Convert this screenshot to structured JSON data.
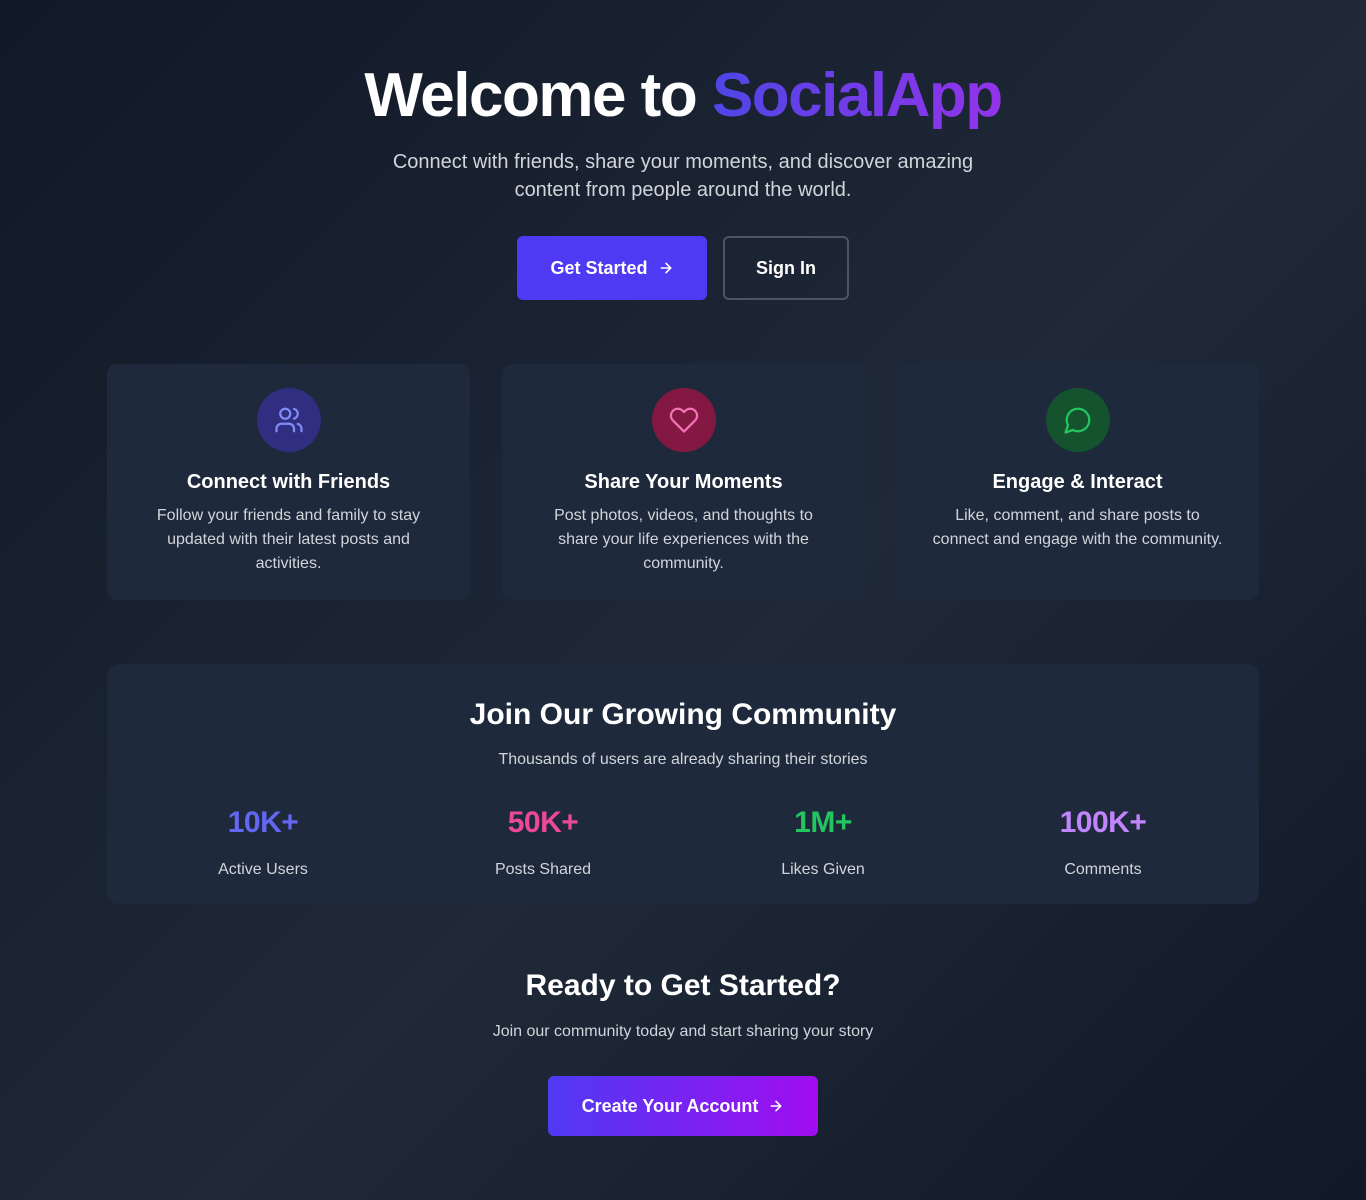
{
  "hero": {
    "title_prefix": "Welcome to ",
    "title_brand": "SocialApp",
    "subtitle": "Connect with friends, share your moments, and discover amazing content from people around the world.",
    "get_started_label": "Get Started",
    "sign_in_label": "Sign In"
  },
  "features": [
    {
      "icon": "users-icon",
      "title": "Connect with Friends",
      "description": "Follow your friends and family to stay updated with their latest posts and activities."
    },
    {
      "icon": "heart-icon",
      "title": "Share Your Moments",
      "description": "Post photos, videos, and thoughts to share your life experiences with the community."
    },
    {
      "icon": "message-circle-icon",
      "title": "Engage & Interact",
      "description": "Like, comment, and share posts to connect and engage with the community."
    }
  ],
  "community": {
    "title": "Join Our Growing Community",
    "subtitle": "Thousands of users are already sharing their stories",
    "stats": [
      {
        "value": "10K+",
        "label": "Active Users"
      },
      {
        "value": "50K+",
        "label": "Posts Shared"
      },
      {
        "value": "1M+",
        "label": "Likes Given"
      },
      {
        "value": "100K+",
        "label": "Comments"
      }
    ]
  },
  "cta": {
    "title": "Ready to Get Started?",
    "subtitle": "Join our community today and start sharing your story",
    "button_label": "Create Your Account"
  },
  "colors": {
    "primary": "#4f3af3",
    "purple": "#9333ea",
    "card_bg": "#1e293b",
    "stat_blue": "#6366f1",
    "stat_pink": "#ec4899",
    "stat_green": "#22c55e",
    "stat_purple": "#c084fc"
  }
}
